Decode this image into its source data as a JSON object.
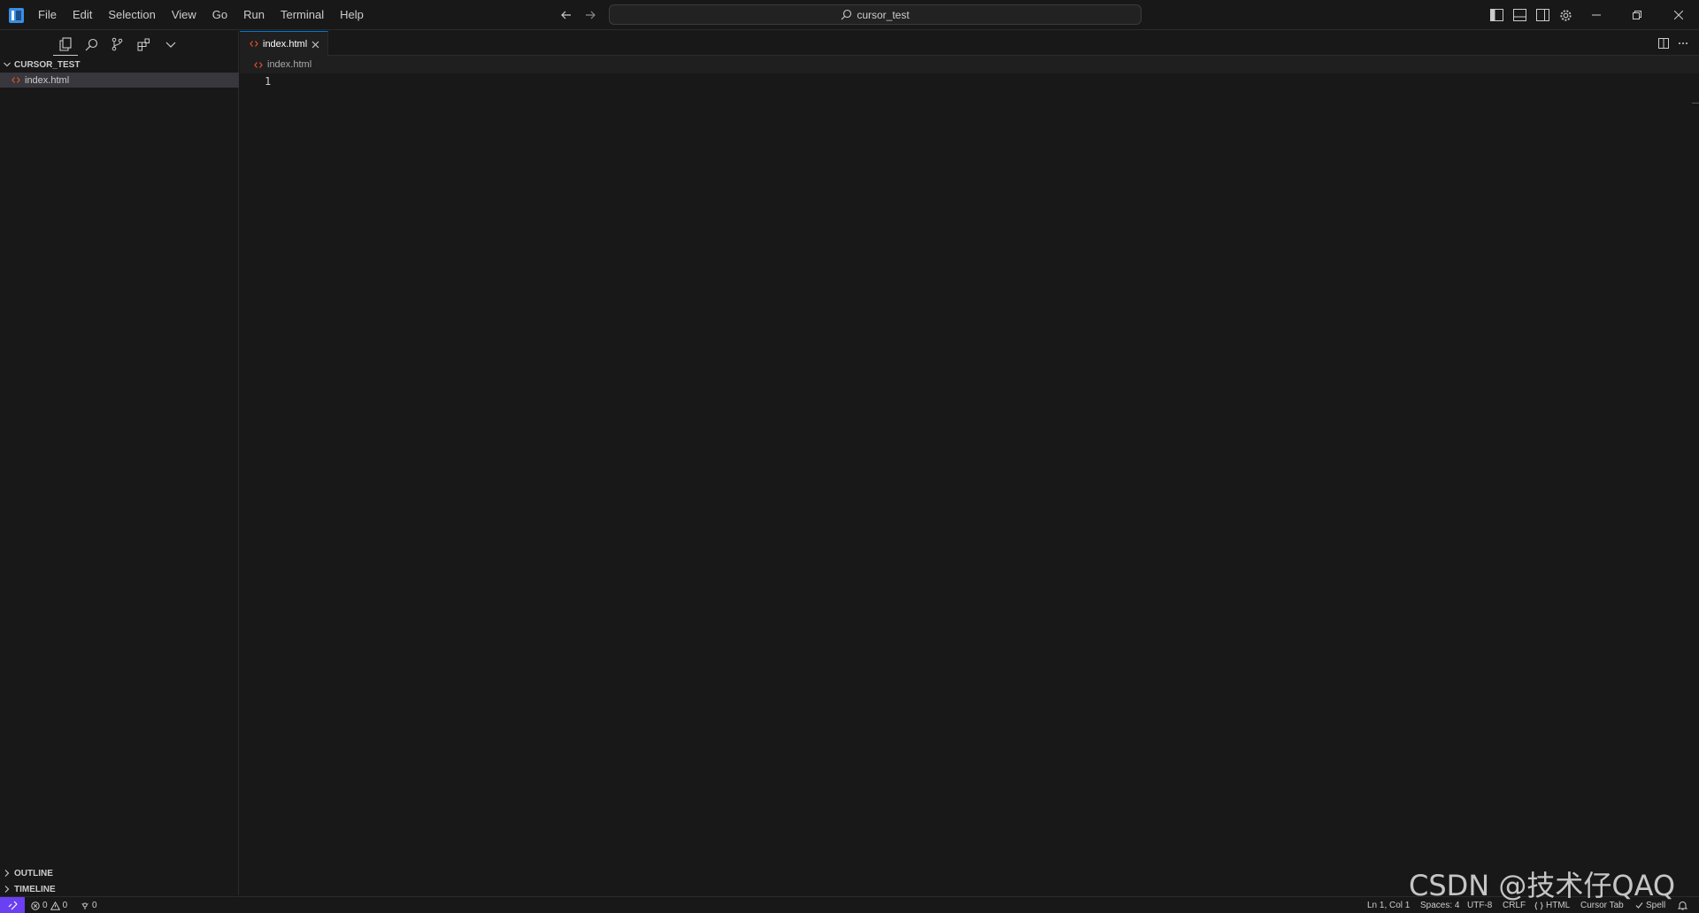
{
  "menu": [
    "File",
    "Edit",
    "Selection",
    "View",
    "Go",
    "Run",
    "Terminal",
    "Help"
  ],
  "search": {
    "text": "cursor_test"
  },
  "explorer": {
    "folder": "CURSOR_TEST",
    "files": [
      "index.html"
    ],
    "sections": [
      "OUTLINE",
      "TIMELINE"
    ]
  },
  "tab": {
    "label": "index.html"
  },
  "breadcrumb": {
    "file": "index.html"
  },
  "editor": {
    "line_numbers": [
      "1"
    ]
  },
  "status": {
    "errors": "0",
    "warnings": "0",
    "ports": "0",
    "position": "Ln 1, Col 1",
    "spaces": "Spaces: 4",
    "encoding": "UTF-8",
    "eol": "CRLF",
    "language": "HTML",
    "cursor_tab": "Cursor Tab",
    "spell": "Spell"
  },
  "watermark": "CSDN @技术仔QAQ",
  "colors": {
    "accent": "#0078d4",
    "remote": "#6b3ff2",
    "html_icon": "#e44d26",
    "logo": "#3a8ee6"
  },
  "icons": [
    "app-logo-icon",
    "arrow-left-icon",
    "arrow-right-icon",
    "search-icon",
    "toggle-primary-sidebar-icon",
    "toggle-panel-icon",
    "toggle-secondary-sidebar-icon",
    "gear-icon",
    "minimize-icon",
    "restore-icon",
    "close-icon",
    "files-icon",
    "search-icon",
    "source-control-icon",
    "extensions-icon",
    "chevron-down-icon",
    "html-file-icon",
    "split-editor-icon",
    "more-actions-icon",
    "remote-icon",
    "error-icon",
    "warning-icon",
    "ports-icon",
    "bell-icon"
  ]
}
